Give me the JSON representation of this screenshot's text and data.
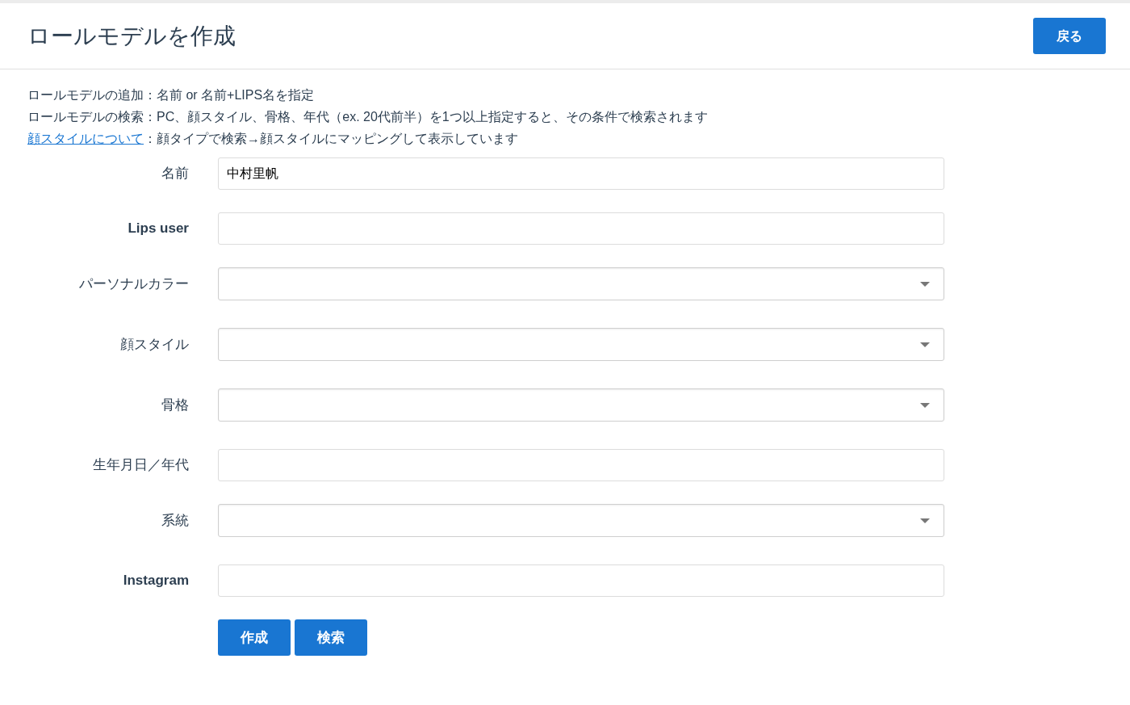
{
  "header": {
    "title": "ロールモデルを作成",
    "back_button": "戻る"
  },
  "help": [
    {
      "lead": "ロールモデルの追加",
      "lead_is_link": false,
      "text": "：名前 or 名前+LIPS名を指定"
    },
    {
      "lead": "ロールモデルの検索",
      "lead_is_link": false,
      "text": "：PC、顔スタイル、骨格、年代（ex. 20代前半）を1つ以上指定すると、その条件で検索されます"
    },
    {
      "lead": "顔スタイルについて",
      "lead_is_link": true,
      "text": "：顔タイプで検索→顔スタイルにマッピングして表示しています"
    }
  ],
  "form": [
    {
      "label": "名前",
      "bold": false,
      "kind": "text",
      "value": "中村里帆"
    },
    {
      "label": "Lips user",
      "bold": true,
      "kind": "text"
    },
    {
      "label": "パーソナルカラー",
      "bold": false,
      "kind": "select"
    },
    {
      "label": "顔スタイル",
      "bold": false,
      "kind": "select"
    },
    {
      "label": "骨格",
      "bold": false,
      "kind": "select"
    },
    {
      "label": "生年月日／年代",
      "bold": false,
      "kind": "text"
    },
    {
      "label": "系統",
      "bold": false,
      "kind": "select"
    },
    {
      "label": "Instagram",
      "bold": true,
      "kind": "text"
    }
  ],
  "buttons": [
    "作成",
    "検索"
  ]
}
